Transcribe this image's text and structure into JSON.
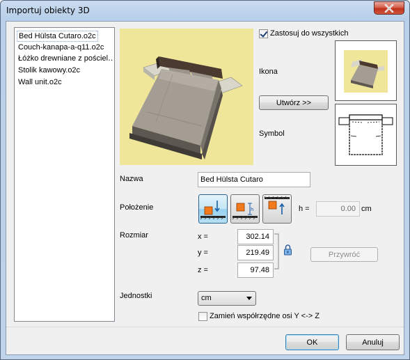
{
  "window": {
    "title": "Importuj obiekty 3D"
  },
  "file_list": {
    "items": [
      {
        "label": "Bed Hülsta Cutaro.o2c",
        "selected": true
      },
      {
        "label": "Couch-kanapa-a-q11.o2c",
        "selected": false
      },
      {
        "label": "Łóżko drewniane z pościel…",
        "selected": false
      },
      {
        "label": "Stolik kawowy.o2c",
        "selected": false
      },
      {
        "label": "Wall unit.o2c",
        "selected": false
      }
    ]
  },
  "options": {
    "apply_all_label": "Zastosuj do wszystkich",
    "apply_all_checked": true,
    "icon_label": "Ikona",
    "create_button": "Utwórz >>",
    "symbol_label": "Symbol"
  },
  "form": {
    "name_label": "Nazwa",
    "name_value": "Bed Hülsta Cutaro",
    "position_label": "Położenie",
    "h_label": "h =",
    "h_value": "0.00",
    "h_unit": "cm",
    "size_label": "Rozmiar",
    "x_label": "x =",
    "x_value": "302.14",
    "y_label": "y =",
    "y_value": "219.49",
    "z_label": "z =",
    "z_value": "97.48",
    "restore_button": "Przywróć",
    "units_label": "Jednostki",
    "units_value": "cm",
    "swap_axes_label": "Zamień współrzędne osi Y <-> Z",
    "swap_axes_checked": false
  },
  "buttons": {
    "ok": "OK",
    "cancel": "Anuluj"
  },
  "colors": {
    "preview_background": "#efe69a",
    "title_bar": "#b9d0ea",
    "close_button": "#c0311c"
  }
}
